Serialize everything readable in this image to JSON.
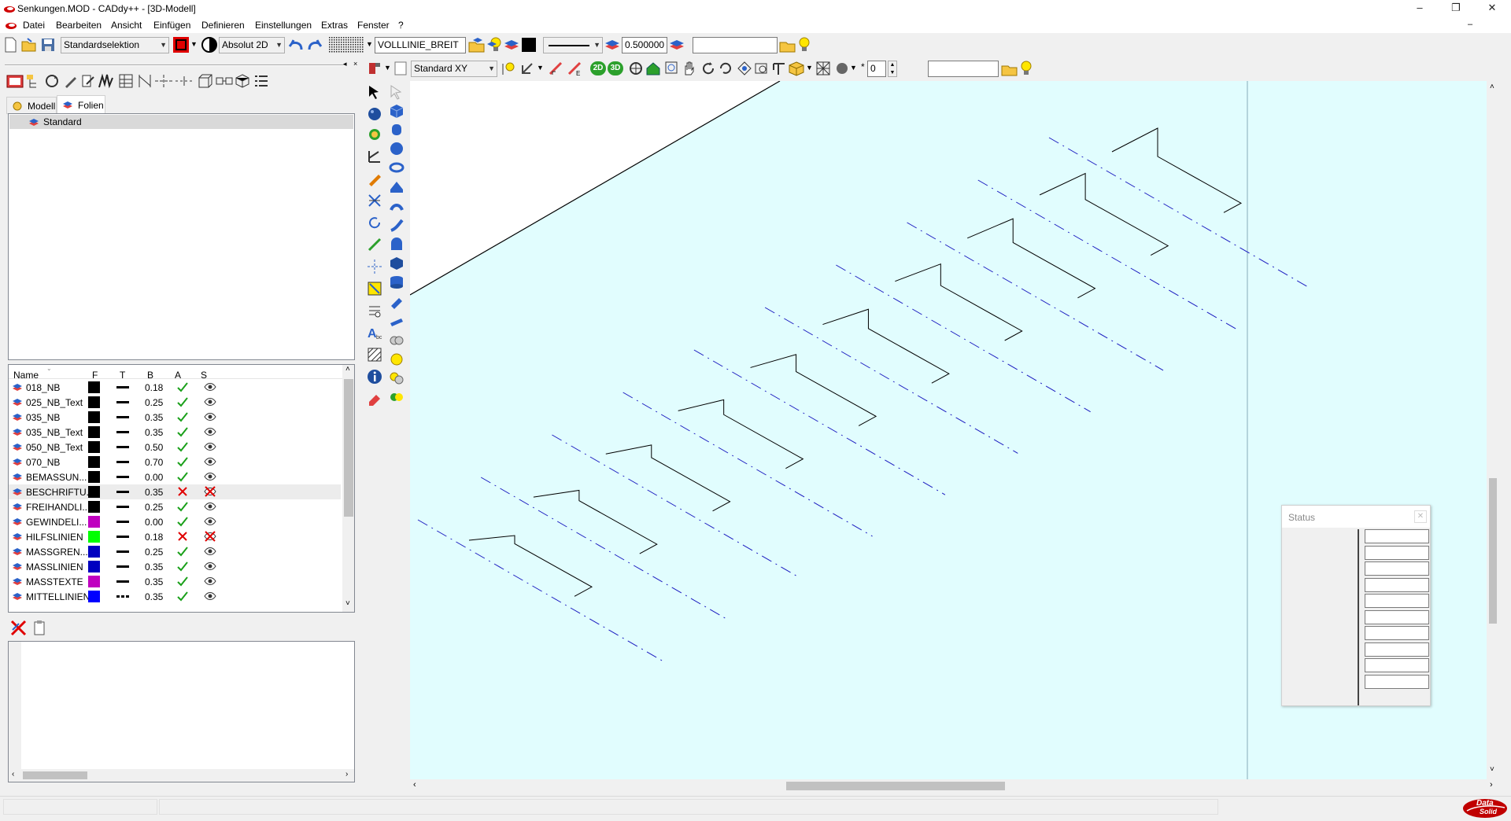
{
  "titlebar": {
    "title": "Senkungen.MOD  -  CADdy++ - [3D-Modell]",
    "minimize": "–",
    "restore": "❐",
    "close": "✕",
    "child_minimize": "–"
  },
  "menu": [
    "Datei",
    "Bearbeiten",
    "Ansicht",
    "Einfügen",
    "Definieren",
    "Einstellungen",
    "Extras",
    "Fenster",
    "?"
  ],
  "toolbar1": {
    "selection_mode": "Standardselektion",
    "coord_mode": "Absolut 2D",
    "line_type_name": "VOLLLINIE_BREIT",
    "line_width": "0.500000",
    "free_field": ""
  },
  "toolbar2": {
    "view": "Standard XY",
    "btn_2d": "2D",
    "btn_3d": "3D",
    "spin_value": "0",
    "free_field": ""
  },
  "left_panel": {
    "tabs": [
      "Modell",
      "Folien"
    ],
    "active_tab": "Folien",
    "tree_item": "Standard",
    "columns": [
      "Name",
      "F",
      "T",
      "B",
      "A",
      "S"
    ],
    "layers": [
      {
        "name": "018_NB",
        "color": "#000000",
        "width": "0.18",
        "active": true,
        "visible": true,
        "icon": "layer-icon"
      },
      {
        "name": "025_NB_Text",
        "color": "#000000",
        "width": "0.25",
        "active": true,
        "visible": true,
        "icon": "layer-icon"
      },
      {
        "name": "035_NB",
        "color": "#000000",
        "width": "0.35",
        "active": true,
        "visible": true,
        "icon": "layer-icon"
      },
      {
        "name": "035_NB_Text",
        "color": "#000000",
        "width": "0.35",
        "active": true,
        "visible": true,
        "icon": "layer-icon"
      },
      {
        "name": "050_NB_Text",
        "color": "#000000",
        "width": "0.50",
        "active": true,
        "visible": true,
        "icon": "layer-icon"
      },
      {
        "name": "070_NB",
        "color": "#000000",
        "width": "0.70",
        "active": true,
        "visible": true,
        "icon": "layer-icon"
      },
      {
        "name": "BEMASSUN...",
        "color": "#000000",
        "width": "0.00",
        "active": true,
        "visible": true,
        "icon": "dimension-icon"
      },
      {
        "name": "BESCHRIFTU...",
        "color": "#000000",
        "width": "0.35",
        "active": false,
        "visible": false,
        "icon": "label-icon"
      },
      {
        "name": "FREIHANDLI...",
        "color": "#000000",
        "width": "0.25",
        "active": true,
        "visible": true,
        "icon": "layer-icon"
      },
      {
        "name": "GEWINDELI...",
        "color": "#c000c0",
        "width": "0.00",
        "active": true,
        "visible": true,
        "icon": "thread-icon"
      },
      {
        "name": "HILFSLINIEN",
        "color": "#00ff00",
        "width": "0.18",
        "active": false,
        "visible": false,
        "icon": "helpline-icon"
      },
      {
        "name": "MASSGREN...",
        "color": "#0000c0",
        "width": "0.25",
        "active": true,
        "visible": true,
        "icon": "dimension-icon"
      },
      {
        "name": "MASSLINIEN",
        "color": "#0000c0",
        "width": "0.35",
        "active": true,
        "visible": true,
        "icon": "dimension-icon"
      },
      {
        "name": "MASSTEXTE",
        "color": "#c000c0",
        "width": "0.35",
        "active": true,
        "visible": true,
        "icon": "dimension-icon"
      },
      {
        "name": "MITTELLINIEN",
        "color": "#0000ff",
        "width": "0.35",
        "active": true,
        "visible": true,
        "icon": "centerline-icon"
      }
    ]
  },
  "status_window": {
    "title": "Status",
    "close": "✕",
    "fields": [
      "",
      "",
      "",
      "",
      "",
      "",
      "",
      "",
      "",
      ""
    ]
  },
  "colors": {
    "canvas": "#e1fdfe",
    "accent": "#c00000"
  },
  "statusbar": {
    "left": "",
    "right": "",
    "logo_top": "Data",
    "logo_bottom": "Solid"
  }
}
